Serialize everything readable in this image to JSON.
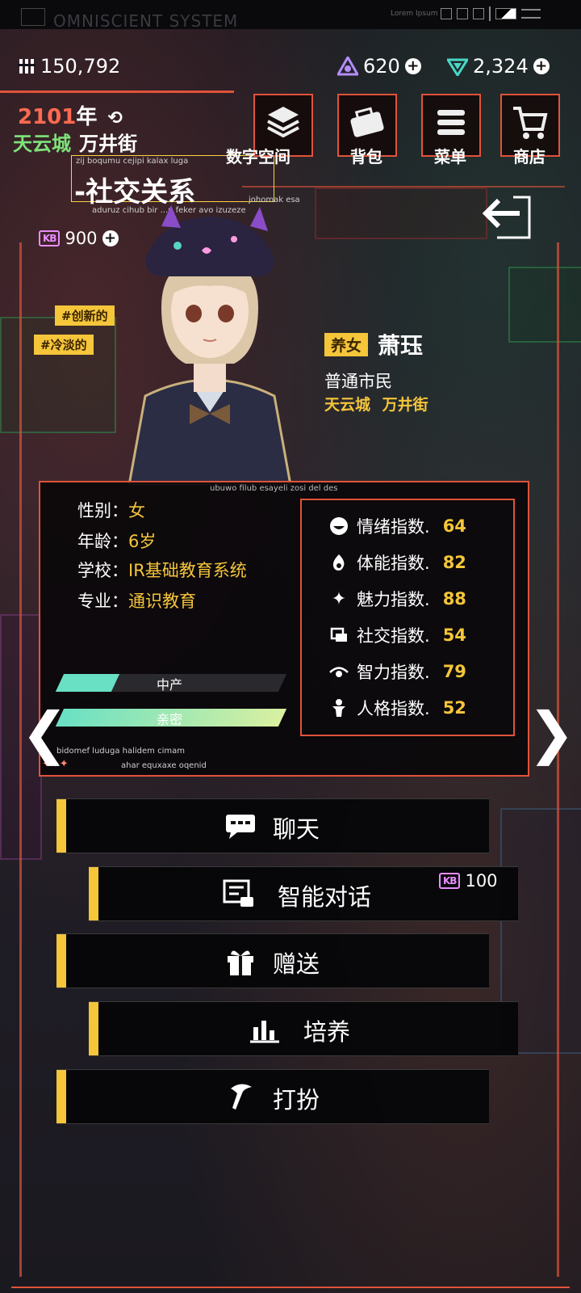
{
  "topbar": {
    "title": "OMNISCIENT  SYSTEM",
    "lorem": "Lorem Ipsum"
  },
  "resources": {
    "coins": "150,792",
    "crystals": "620",
    "gems": "2,324",
    "energy": "900"
  },
  "header": {
    "year": "2101",
    "year_suffix": "年",
    "city": "天云城",
    "street": "万井街",
    "page_title": "-社交关系",
    "glyph_line1": "zij boqumu cejipi kalax luga",
    "glyph_line2": "aduruz cihub bir  ...u feker avo izuzeze",
    "glyph_right": "johomak esa"
  },
  "nav": [
    {
      "label": "数字空间",
      "icon": "layers-icon"
    },
    {
      "label": "背包",
      "icon": "bag-icon"
    },
    {
      "label": "菜单",
      "icon": "menu-icon"
    },
    {
      "label": "商店",
      "icon": "cart-icon"
    }
  ],
  "tags": [
    "#创新的",
    "#冷淡的"
  ],
  "character": {
    "role": "养女",
    "name": "萧珏",
    "status": "普通市民",
    "city": "天云城",
    "street": "万井街"
  },
  "panel": {
    "glyph_top": "ubuwo filub esayeli zosi del des",
    "glyph_bottom1": "bidomef luduga halidem cimam",
    "glyph_bottom2": "ahar equxaxe oqenid",
    "info": [
      {
        "label": "性别：",
        "value": "女"
      },
      {
        "label": "年龄：",
        "value": "6岁"
      },
      {
        "label": "学校：",
        "value": "IR基础教育系统"
      },
      {
        "label": "专业：",
        "value": "通识教育"
      }
    ],
    "bars": [
      {
        "label": "中产",
        "fill": 0.25
      },
      {
        "label": "亲密",
        "fill": 1.0
      }
    ],
    "stats": [
      {
        "label": "情绪指数.",
        "value": "64",
        "icon": "mood-icon"
      },
      {
        "label": "体能指数.",
        "value": "82",
        "icon": "fire-icon"
      },
      {
        "label": "魅力指数.",
        "value": "88",
        "icon": "sparkle-icon"
      },
      {
        "label": "社交指数.",
        "value": "54",
        "icon": "social-icon"
      },
      {
        "label": "智力指数.",
        "value": "79",
        "icon": "eye-icon"
      },
      {
        "label": "人格指数.",
        "value": "52",
        "icon": "person-icon"
      }
    ]
  },
  "actions": [
    {
      "label": "聊天",
      "icon": "chat-icon"
    },
    {
      "label": "智能对话",
      "icon": "ai-chat-icon",
      "cost": "100"
    },
    {
      "label": "赠送",
      "icon": "gift-icon"
    },
    {
      "label": "培养",
      "icon": "growth-icon"
    },
    {
      "label": "打扮",
      "icon": "dressup-icon"
    }
  ],
  "colors": {
    "accent": "#e0533a",
    "gold": "#f5c53a",
    "green": "#7de37a"
  }
}
